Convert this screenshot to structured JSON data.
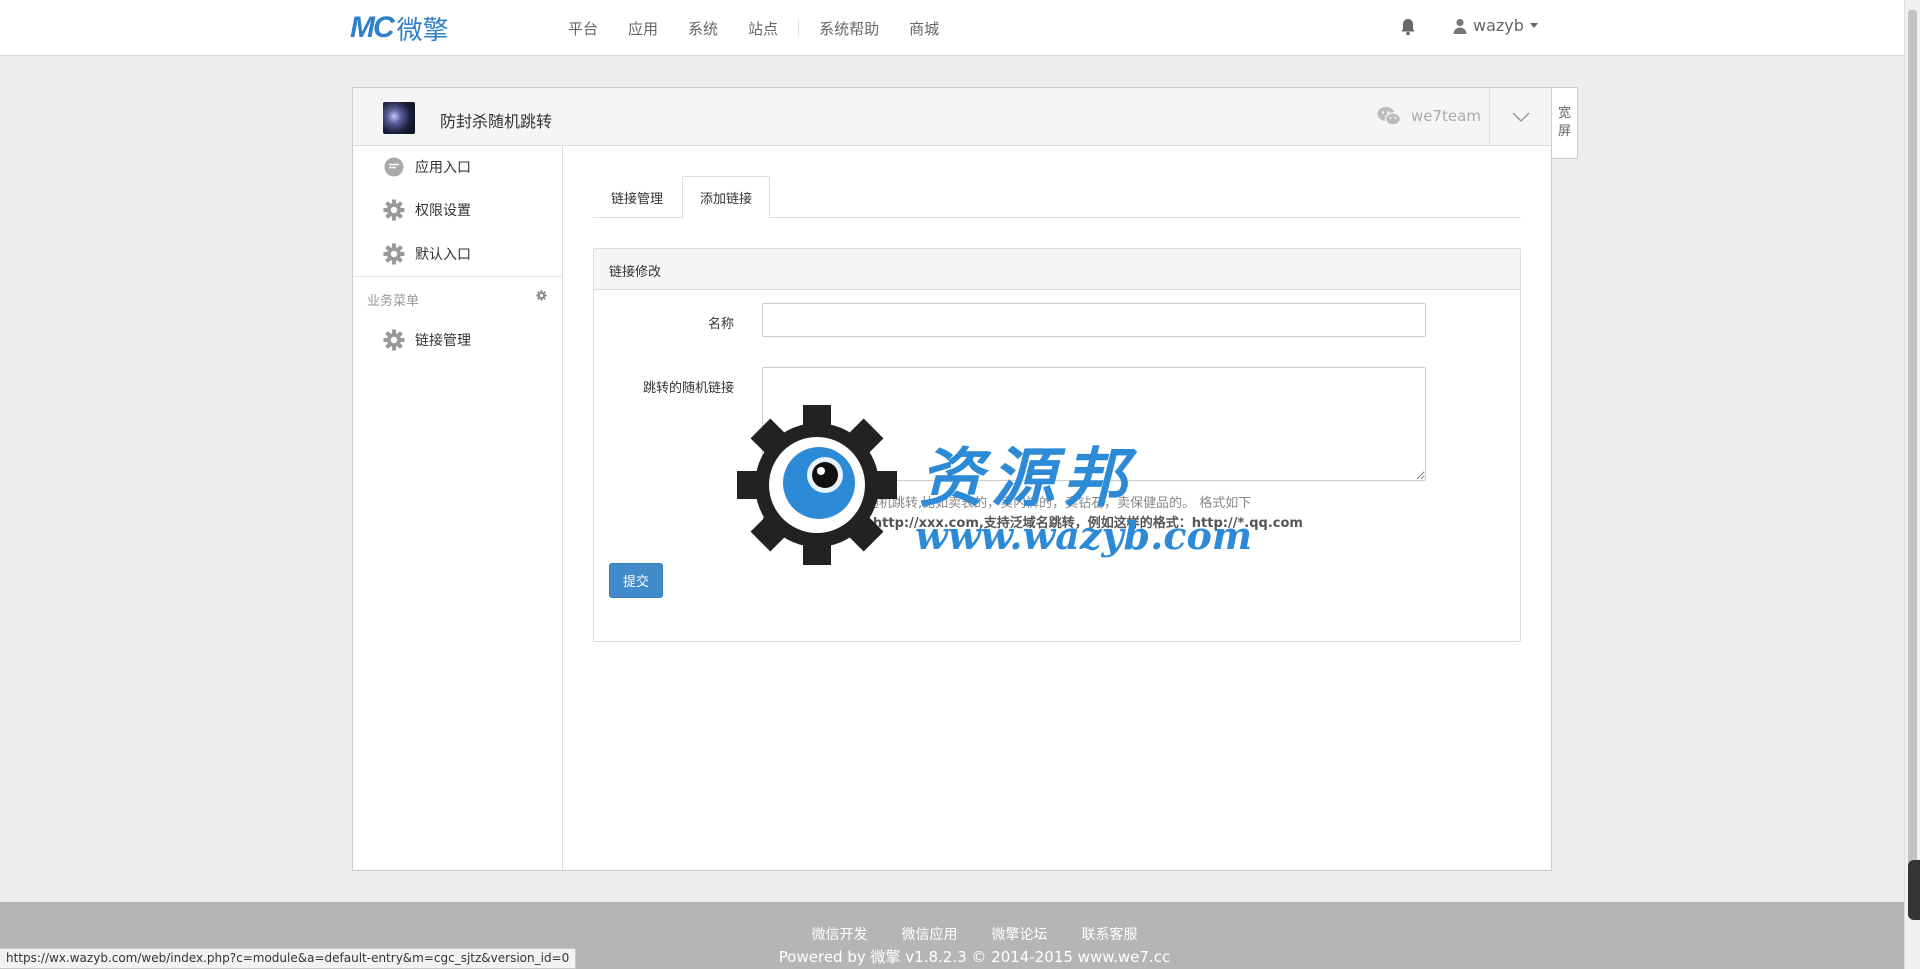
{
  "navbar": {
    "logo_mark": "MC",
    "logo_text": "微擎",
    "links": [
      "平台",
      "应用",
      "系统",
      "站点",
      "系统帮助",
      "商城"
    ],
    "username": "wazyb"
  },
  "module": {
    "title": "防封杀随机跳转",
    "account": "we7team",
    "wide_label_1": "宽",
    "wide_label_2": "屏"
  },
  "sidebar": {
    "items": [
      {
        "label": "应用入口",
        "icon": "comment-icon"
      },
      {
        "label": "权限设置",
        "icon": "gear-icon"
      },
      {
        "label": "默认入口",
        "icon": "gear-icon"
      }
    ],
    "section_title": "业务菜单",
    "business_items": [
      {
        "label": "链接管理",
        "icon": "gear-icon"
      }
    ]
  },
  "tabs": [
    {
      "label": "链接管理",
      "active": false
    },
    {
      "label": "添加链接",
      "active": true
    }
  ],
  "form": {
    "heading": "链接修改",
    "name_label": "名称",
    "name_value": "",
    "links_label": "跳转的随机链接",
    "links_value": "",
    "help_line1": "设置多个链接可以随机跳转,比如卖表的，卖内裤的，卖钻石，卖保健品的。 格式如下",
    "help_line2": "http://xxx.com,http://xxx.com,支持泛域名跳转，例如这样的格式：http://*.qq.com",
    "submit_label": "提交"
  },
  "watermark": {
    "title": "资源邦",
    "url": "www.wazyb.com"
  },
  "footer": {
    "links": [
      "微信开发",
      "微信应用",
      "微擎论坛",
      "联系客服"
    ],
    "copyright": "Powered by 微擎 v1.8.2.3 © 2014-2015 www.we7.cc"
  },
  "statusbar": {
    "url": "https://wx.wazyb.com/web/index.php?c=module&a=default-entry&m=cgc_sjtz&version_id=0"
  },
  "colors": {
    "primary": "#428bca",
    "logo": "#2f7fc9",
    "watermark": "#2d8ad6",
    "footer_bg": "#b5b5b5"
  }
}
